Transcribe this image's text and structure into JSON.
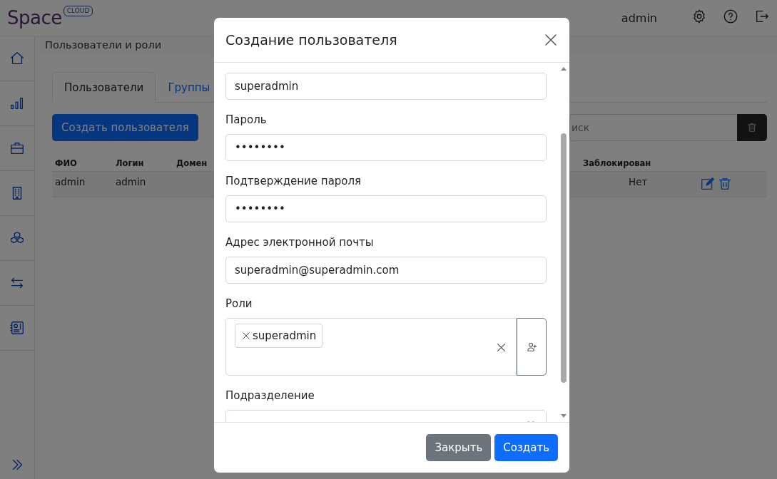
{
  "header": {
    "logo_word": "Space",
    "logo_badge": "CLOUD",
    "user": "admin"
  },
  "breadcrumb": "Пользователи и роли",
  "tabs": [
    {
      "label": "Пользователи",
      "selected": true
    },
    {
      "label": "Группы",
      "selected": false
    }
  ],
  "create_button": "Создать пользователя",
  "search": {
    "placeholder": "иск"
  },
  "table": {
    "columns": [
      "ФИО",
      "Логин",
      "Домен",
      "Заблокирован"
    ],
    "rows": [
      {
        "fio": "admin",
        "login": "admin",
        "blocked": "Нет"
      }
    ]
  },
  "modal": {
    "title": "Создание пользователя",
    "fields": [
      {
        "kind": "text",
        "value": "superadmin"
      },
      {
        "kind": "text",
        "label": "Пароль",
        "value": "••••••••"
      },
      {
        "kind": "text",
        "label": "Подтверждение пароля",
        "value": "••••••••"
      },
      {
        "kind": "text",
        "label": "Адрес электронной почты",
        "value": "superadmin@superadmin.com"
      },
      {
        "kind": "tags",
        "label": "Роли",
        "tags": [
          "superadmin"
        ]
      },
      {
        "kind": "select",
        "label": "Подразделение"
      }
    ],
    "buttons": [
      {
        "label": "Закрыть",
        "kind": "secondary"
      },
      {
        "label": "Создать",
        "kind": "primary"
      }
    ]
  }
}
